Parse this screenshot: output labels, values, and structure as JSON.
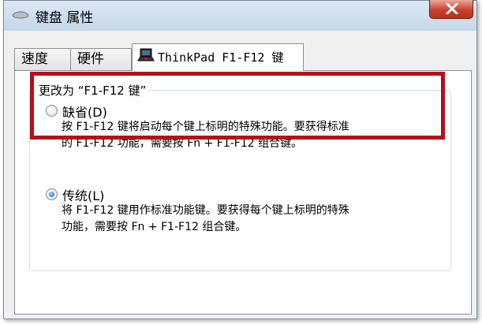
{
  "window": {
    "title": "键盘 属性"
  },
  "tabs": [
    {
      "label": "速度"
    },
    {
      "label": "硬件"
    },
    {
      "label": "ThinkPad F1-F12 键"
    }
  ],
  "group": {
    "legend": "更改为 “F1-F12 键”"
  },
  "options": [
    {
      "label": "缺省(D)",
      "selected": false,
      "description_line1": "按 F1-F12 键将启动每个键上标明的特殊功能。要获得标准",
      "description_line2": "的 F1-F12 功能，需要按 Fn + F1-F12 组合键。"
    },
    {
      "label": "传统(L)",
      "selected": true,
      "description_line1": "将 F1-F12 键用作标准功能键。要获得每个键上标明的特殊",
      "description_line2": "功能，需要按 Fn + F1-F12 组合键。"
    }
  ],
  "colors": {
    "highlight": "#b50f1c",
    "close_button": "#c7412c"
  },
  "icons": {
    "title": "keyboard-icon",
    "close": "close-icon",
    "tab": "thinkpad-laptop-icon"
  }
}
